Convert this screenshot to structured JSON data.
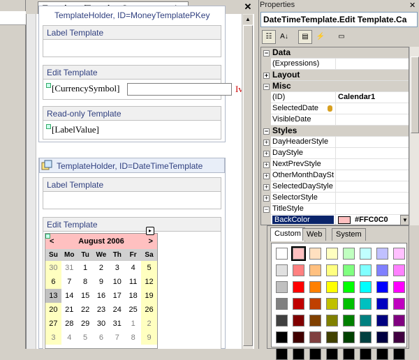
{
  "document": {
    "tab_title": "Templates/TemplateStorage.ascx*",
    "holder1_title": "TemplateHolder, ID=MoneyTemplatePKey",
    "holder1_sections": [
      {
        "header": "Label Template",
        "content": ""
      },
      {
        "header": "Edit Template",
        "content": "[CurrencySymbol]"
      },
      {
        "header": "Read-only Template",
        "content": "[LabelValue]"
      }
    ],
    "edit_trailing": "Iv",
    "holder2_title": "TemplateHolder, ID=DateTimeTemplate",
    "holder2_sections": [
      {
        "header": "Label Template"
      },
      {
        "header": "Edit Template"
      }
    ]
  },
  "calendar": {
    "prev": "<",
    "next": ">",
    "month": "August 2006",
    "day_headers": [
      "Su",
      "Mo",
      "Tu",
      "We",
      "Th",
      "Fr",
      "Sa"
    ],
    "weeks": [
      [
        "30",
        "31",
        "1",
        "2",
        "3",
        "4",
        "5"
      ],
      [
        "6",
        "7",
        "8",
        "9",
        "10",
        "11",
        "12"
      ],
      [
        "13",
        "14",
        "15",
        "16",
        "17",
        "18",
        "19"
      ],
      [
        "20",
        "21",
        "22",
        "23",
        "24",
        "25",
        "26"
      ],
      [
        "27",
        "28",
        "29",
        "30",
        "31",
        "1",
        "2"
      ],
      [
        "3",
        "4",
        "5",
        "6",
        "7",
        "8",
        "9"
      ]
    ],
    "title_color": "#FFC0C0",
    "weekend_color": "#FFFFC0"
  },
  "properties": {
    "panel_title": "Properties",
    "object": "DateTimeTemplate.Edit  Template.Ca",
    "toolbar": [
      "categorized-icon",
      "alphabetical-icon",
      "properties-icon",
      "events-icon",
      "property-pages-icon"
    ],
    "rows": [
      {
        "type": "cat",
        "sign": "−",
        "name": "Data"
      },
      {
        "type": "prop",
        "name": "(Expressions)",
        "value": ""
      },
      {
        "type": "cat",
        "sign": "+",
        "name": "Layout"
      },
      {
        "type": "cat",
        "sign": "−",
        "name": "Misc"
      },
      {
        "type": "prop",
        "name": "(ID)",
        "value": "Calendar1"
      },
      {
        "type": "prop",
        "name": "SelectedDate",
        "value": ""
      },
      {
        "type": "prop",
        "name": "VisibleDate",
        "value": ""
      },
      {
        "type": "cat",
        "sign": "−",
        "name": "Styles"
      },
      {
        "type": "prop",
        "sign": "+",
        "name": "DayHeaderStyle",
        "value": ""
      },
      {
        "type": "prop",
        "sign": "+",
        "name": "DayStyle",
        "value": ""
      },
      {
        "type": "prop",
        "sign": "+",
        "name": "NextPrevStyle",
        "value": ""
      },
      {
        "type": "prop",
        "sign": "+",
        "name": "OtherMonthDaySt",
        "value": ""
      },
      {
        "type": "prop",
        "sign": "+",
        "name": "SelectedDayStyle",
        "value": ""
      },
      {
        "type": "prop",
        "sign": "+",
        "name": "SelectorStyle",
        "value": ""
      },
      {
        "type": "prop",
        "sign": "−",
        "name": "TitleStyle",
        "value": ""
      },
      {
        "type": "selected",
        "name": "BackColor",
        "value": "#FFC0C0"
      }
    ]
  },
  "color_picker": {
    "tabs": [
      "Custom",
      "Web",
      "System"
    ],
    "active_tab": "Custom",
    "swatches": [
      [
        "#ffffff",
        "#ffc0c0",
        "#ffe0c0",
        "#ffffc0",
        "#c0ffc0",
        "#c0ffff",
        "#c0c0ff",
        "#ffc0ff"
      ],
      [
        "#e0e0e0",
        "#ff8080",
        "#ffc080",
        "#ffff80",
        "#80ff80",
        "#80ffff",
        "#8080ff",
        "#ff80ff"
      ],
      [
        "#c0c0c0",
        "#ff0000",
        "#ff8000",
        "#ffff00",
        "#00ff00",
        "#00ffff",
        "#0000ff",
        "#ff00ff"
      ],
      [
        "#808080",
        "#c00000",
        "#c04000",
        "#c0c000",
        "#00c000",
        "#00c0c0",
        "#0000c0",
        "#c000c0"
      ],
      [
        "#404040",
        "#800000",
        "#804000",
        "#808000",
        "#008000",
        "#008080",
        "#000080",
        "#800080"
      ],
      [
        "#000000",
        "#400000",
        "#804040",
        "#404000",
        "#004000",
        "#004040",
        "#000040",
        "#400040"
      ],
      [
        "#000000",
        "#000000",
        "#000000",
        "#000000",
        "#000000",
        "#000000",
        "#000000",
        "#000000"
      ]
    ]
  }
}
